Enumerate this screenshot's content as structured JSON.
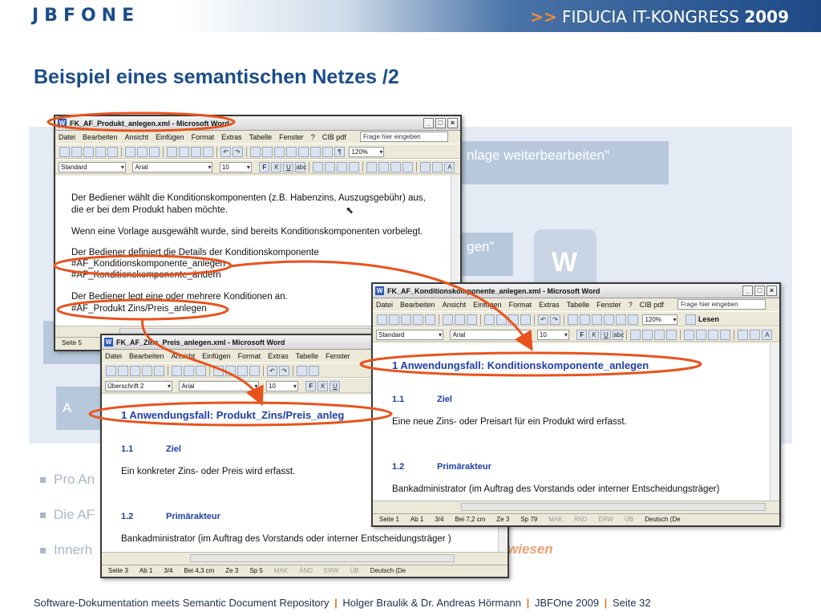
{
  "header": {
    "logo": "JBFONE",
    "kongress_arrow": ">>",
    "kongress_text": "FIDUCIA IT-KONGRESS",
    "kongress_year": "2009"
  },
  "title": "Beispiel eines semantischen Netzes  /2",
  "background": {
    "box1": "nlage weiterbearbeiten\"",
    "box2": "gen\"",
    "box3": "A"
  },
  "bullets": [
    "Pro An",
    "Die AF",
    "Innerh"
  ],
  "bullet_tail": "wiesen",
  "footer": {
    "part1": "Software-Dokumentation meets Semantic Document Repository",
    "part2": "Holger Braulik & Dr. Andreas Hörmann",
    "part3": "JBFOne 2009",
    "part4": "Seite 32",
    "sep": "|"
  },
  "word_menu": [
    "Datei",
    "Bearbeiten",
    "Ansicht",
    "Einfügen",
    "Format",
    "Extras",
    "Tabelle",
    "Fenster",
    "?",
    "CIB pdf"
  ],
  "word_ask": "Frage hier eingeben",
  "win1": {
    "title": "FK_AF_Produkt_anlegen.xml - Microsoft Word",
    "style": "Standard",
    "font": "Arial",
    "size": "10",
    "zoom": "120%",
    "paragraphs": [
      "Der Bediener wählt die Konditionskomponenten (z.B. Habenzins, Auszugsgebühr) aus,",
      "die er bei dem Produkt haben möchte.",
      "Wenn eine Vorlage ausgewählt wurde, sind bereits Konditionskomponenten vorbelegt.",
      "Der Bediener definiert die Details der Konditionskomponente",
      "#AF_Konditionskomponente_anlegen",
      "#AF_Konditionskomponente_ändern",
      "Der Bediener legt eine oder mehrere Konditionen an.",
      "#AF_Produkt Zins/Preis_anlegen"
    ],
    "status_page": "Seite  5"
  },
  "win2": {
    "title": "FK_AF_Zins_Preis_anlegen.xml - Microsoft Word",
    "style": "Überschrift 2",
    "font": "Arial",
    "size": "10",
    "heading": "1  Anwendungsfall: Produkt_Zins/Preis_anleg",
    "s1_num": "1.1",
    "s1_title": "Ziel",
    "s1_text": "Ein konkreter Zins- oder Preis wird erfasst.",
    "s2_num": "1.2",
    "s2_title": "Primärakteur",
    "s2_text": "Bankadministrator (im Auftrag des Vorstands oder interner Entscheidungsträger )",
    "status": [
      "Seite  3",
      "Ab  1",
      "3/4",
      "Bei  4,3 cm",
      "Ze  3",
      "Sp  5"
    ],
    "status_dim": [
      "MAK",
      "ÄND",
      "ERW",
      "ÜB"
    ],
    "status_lang": "Deutsch (De"
  },
  "win3": {
    "title": "FK_AF_Konditionskomponente_anlegen.xml - Microsoft Word",
    "style": "Standard",
    "font": "Arial",
    "size": "10",
    "zoom": "120%",
    "read_btn": "Lesen",
    "heading": "1  Anwendungsfall: Konditionskomponente_anlegen",
    "s1_num": "1.1",
    "s1_title": "Ziel",
    "s1_text": "Eine neue Zins- oder Preisart für ein Produkt wird erfasst.",
    "s2_num": "1.2",
    "s2_title": "Primärakteur",
    "s2_text": "Bankadministrator (im Auftrag des Vorstands oder interner Entscheidungsträger)",
    "status": [
      "Seite  1",
      "Ab  1",
      "3/4",
      "Bei  7,2 cm",
      "Ze  3",
      "Sp  79"
    ],
    "status_dim": [
      "MAK",
      "ÄND",
      "ERW",
      "ÜB"
    ],
    "status_lang": "Deutsch (De"
  },
  "colors": {
    "brand": "#1b4d8c",
    "accent": "#e8531c",
    "heading_blue": "#1f3fa8"
  }
}
